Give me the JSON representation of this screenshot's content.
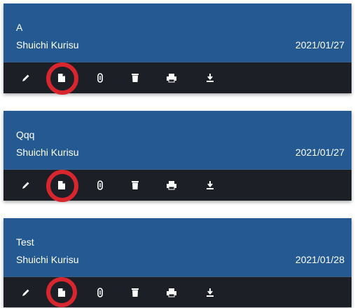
{
  "colors": {
    "header_bg": "#245a91",
    "toolbar_bg": "#1d1f26",
    "icon": "#ffffff",
    "highlight": "#d7262e"
  },
  "toolbar_icons": [
    "pencil-icon",
    "document-icon",
    "paperclip-icon",
    "trash-icon",
    "print-icon",
    "download-icon"
  ],
  "cards": [
    {
      "title": "A",
      "author": "Shuichi Kurisu",
      "date": "2021/01/27"
    },
    {
      "title": "Qqq",
      "author": "Shuichi Kurisu",
      "date": "2021/01/27"
    },
    {
      "title": "Test",
      "author": "Shuichi Kurisu",
      "date": "2021/01/28"
    }
  ]
}
